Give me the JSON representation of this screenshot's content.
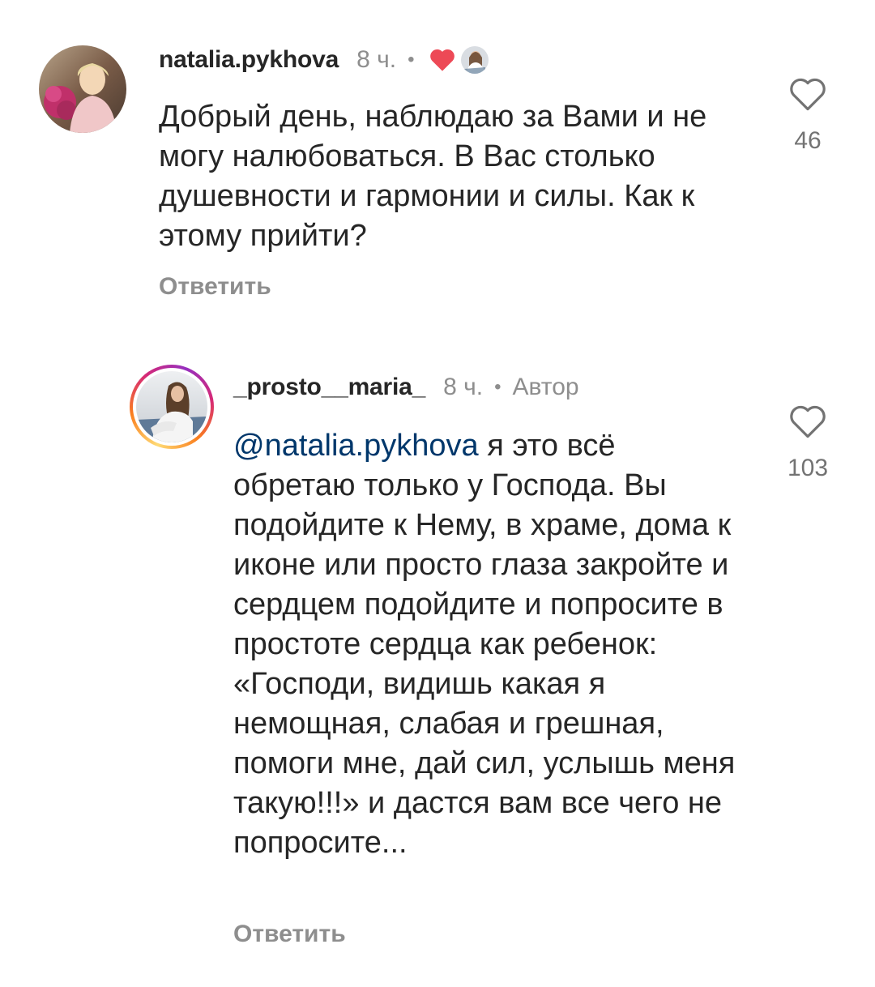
{
  "comments": [
    {
      "username": "natalia.pykhova",
      "time": "8 ч.",
      "separator": "•",
      "text": "Добрый день, наблюдаю за Вами и не могу налюбоваться. В Вас столько душевности и гармонии и силы. Как к этому прийти?",
      "reply_label": "Ответить",
      "like_count": "46",
      "liked_by_author": true,
      "colors": {
        "heart_red": "#ed4956"
      }
    },
    {
      "username": "_prosto__maria_",
      "time": "8 ч.",
      "separator": "•",
      "author_badge": "Автор",
      "mention": "@natalia.pykhova",
      "text": "я это всё обретаю только у Господа. Вы подойдите к Нему, в храме, дома к иконе или просто глаза закройте и сердцем подойдите и попросите в простоте сердца как ребенок: «Господи, видишь какая я немощная, слабая и грешная, помоги мне, дай сил, услышь меня такую!!!» и дастся вам все чего не попросите...",
      "reply_label": "Ответить",
      "like_count": "103"
    }
  ],
  "colors": {
    "mention": "#00376b",
    "secondary_text": "#8e8e8e",
    "primary_text": "#262626"
  },
  "icons": {
    "like": "heart-outline-icon",
    "liked_by_author": "heart-filled-icon"
  }
}
